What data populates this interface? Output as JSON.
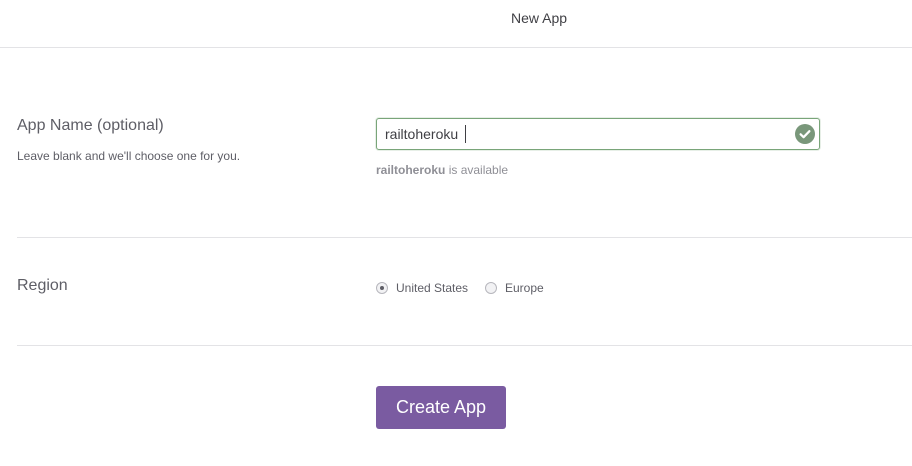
{
  "header": {
    "title": "New App"
  },
  "app_name": {
    "label": "App Name (optional)",
    "help": "Leave blank and we'll choose one for you.",
    "value": "railtoheroku",
    "status_icon": "check-circle-icon",
    "availability_app": "railtoheroku",
    "availability_text": " is available"
  },
  "region": {
    "label": "Region",
    "options": [
      {
        "label": "United States",
        "selected": true
      },
      {
        "label": "Europe",
        "selected": false
      }
    ]
  },
  "actions": {
    "create_label": "Create App"
  },
  "colors": {
    "accent": "#7a5ba1",
    "success": "#79977a",
    "border": "#e3e3e6"
  }
}
